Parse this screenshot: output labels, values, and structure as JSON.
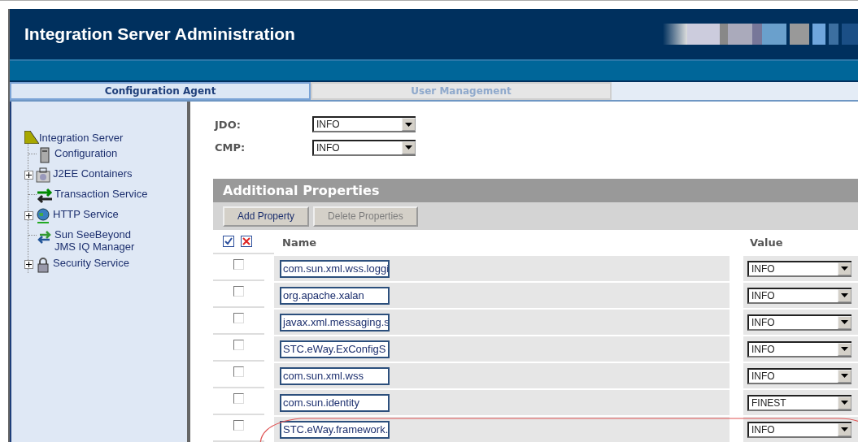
{
  "header": {
    "title": "Integration Server Administration"
  },
  "tabs": [
    {
      "label": "Configuration Agent",
      "selected": true
    },
    {
      "label": "User Management",
      "selected": false
    }
  ],
  "tree": {
    "label": "Integration Server",
    "children": [
      {
        "label": "Configuration",
        "kind": "config",
        "expandable": false
      },
      {
        "label": "J2EE Containers",
        "kind": "containers",
        "expandable": true
      },
      {
        "label": "Transaction Service",
        "kind": "transaction",
        "expandable": false
      },
      {
        "label": "HTTP Service",
        "kind": "http",
        "expandable": true
      },
      {
        "label": "Sun SeeBeyond JMS IQ Manager",
        "kind": "jms",
        "expandable": false
      },
      {
        "label": "Security Service",
        "kind": "security",
        "expandable": true
      }
    ]
  },
  "loggers": [
    {
      "label": "JDO:",
      "value": "INFO"
    },
    {
      "label": "CMP:",
      "value": "INFO"
    }
  ],
  "additional_properties": {
    "title": "Additional Properties",
    "buttons": [
      {
        "label": "Add Property",
        "disabled": false
      },
      {
        "label": "Delete Properties",
        "disabled": true
      }
    ],
    "columns": [
      "Name",
      "Value"
    ],
    "rows": [
      {
        "checked": false,
        "name": "com.sun.xml.wss.loggi",
        "value": "INFO",
        "highlighted": false
      },
      {
        "checked": false,
        "name": "org.apache.xalan",
        "value": "INFO",
        "highlighted": false
      },
      {
        "checked": false,
        "name": "javax.xml.messaging.s",
        "value": "INFO",
        "highlighted": false
      },
      {
        "checked": false,
        "name": "STC.eWay.ExConfigS",
        "value": "INFO",
        "highlighted": false
      },
      {
        "checked": false,
        "name": "com.sun.xml.wss",
        "value": "INFO",
        "highlighted": false
      },
      {
        "checked": false,
        "name": "com.sun.identity",
        "value": "FINEST",
        "highlighted": false
      },
      {
        "checked": false,
        "name": "STC.eWay.framework.",
        "value": "INFO",
        "highlighted": true
      }
    ]
  }
}
